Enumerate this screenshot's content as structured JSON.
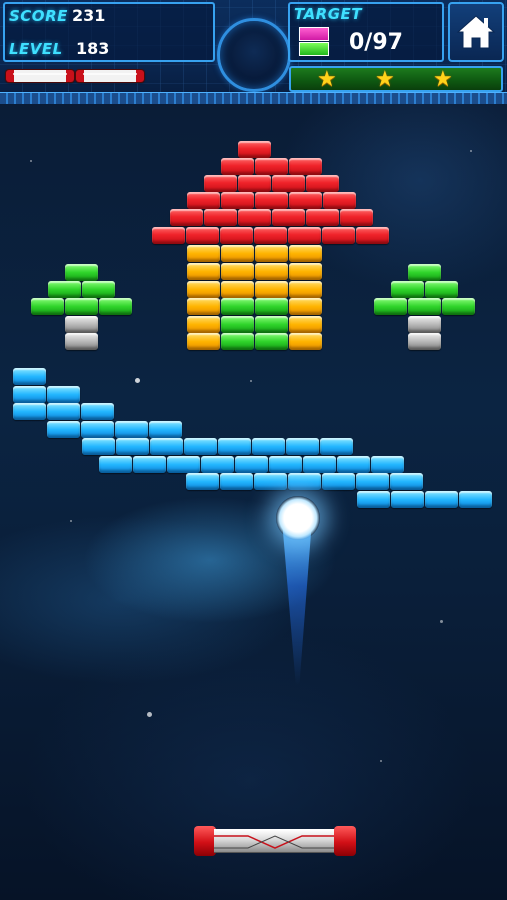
{
  "hud": {
    "score_label": "SCORE",
    "score_value": "231",
    "level_label": "LEVEL",
    "level_value": "183",
    "target_label": "TARGET",
    "target_value": "0/97",
    "home_button": "home-icon",
    "lives_remaining": 2,
    "stars_earned": 3,
    "stars_total": 3
  },
  "colors": {
    "hud_accent": "#3fe0ff",
    "brick_red": "#f0232a",
    "brick_yellow": "#ffb400",
    "brick_green": "#2fd42a",
    "brick_gray": "#b8b8b8",
    "brick_blue": "#23b6ff",
    "star": "#ffd21a"
  },
  "icons": {
    "home": "home-icon",
    "star": "star-icon",
    "target_brick": "target-brick-icon"
  }
}
